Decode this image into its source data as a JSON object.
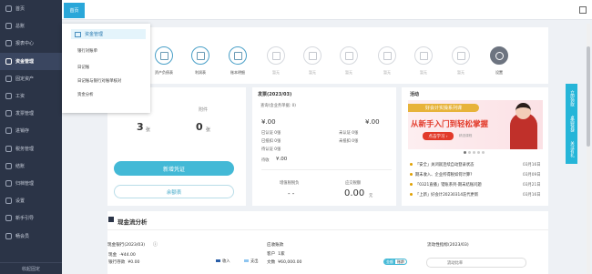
{
  "sidebar": {
    "items": [
      {
        "label": "首页",
        "icon": "home-icon"
      },
      {
        "label": "总账",
        "icon": "ledger-icon"
      },
      {
        "label": "报表中心",
        "icon": "report-icon"
      },
      {
        "label": "资金管理",
        "icon": "fund-icon"
      },
      {
        "label": "固定资产",
        "icon": "asset-icon"
      },
      {
        "label": "工资",
        "icon": "salary-icon"
      },
      {
        "label": "发票管理",
        "icon": "invoice-icon"
      },
      {
        "label": "进销存",
        "icon": "inventory-icon"
      },
      {
        "label": "税务管理",
        "icon": "tax-icon"
      },
      {
        "label": "结账",
        "icon": "closing-icon"
      },
      {
        "label": "归档管理",
        "icon": "archive-icon"
      },
      {
        "label": "设置",
        "icon": "settings-icon"
      },
      {
        "label": "新手引导",
        "icon": "guide-icon"
      },
      {
        "label": "畅会员",
        "icon": "vip-icon"
      }
    ],
    "active_index": 3,
    "bottom": "收起固定"
  },
  "tabs": {
    "home": "首页"
  },
  "menu": {
    "title": "资金管理",
    "items": [
      "银行对账单",
      "日记账",
      "日记账与银行对账单核对",
      "资金分析"
    ]
  },
  "shortcuts": [
    {
      "label": "资产负债表",
      "state": "active"
    },
    {
      "label": "利润表",
      "state": "active"
    },
    {
      "label": "账本明细",
      "state": "active"
    },
    {
      "label": "暂无",
      "state": "disabled"
    },
    {
      "label": "暂无",
      "state": "disabled"
    },
    {
      "label": "暂无",
      "state": "disabled"
    },
    {
      "label": "暂无",
      "state": "disabled"
    },
    {
      "label": "暂无",
      "state": "disabled"
    },
    {
      "label": "暂无",
      "state": "disabled"
    },
    {
      "label": "设置",
      "state": "dark"
    }
  ],
  "voucher": {
    "left_count": "3",
    "left_unit": "张",
    "right_label": "附件",
    "right_count": "0",
    "right_unit": "张",
    "primary_btn": "新增凭证",
    "secondary_btn": "余额表"
  },
  "bills": {
    "title": "发票(2023/03)",
    "query": "查询(含业务单据: 0)",
    "left_amount": "¥.00",
    "right_amount": "¥.00",
    "left_rows": [
      "已认证  0张",
      "已抵扣  0张",
      "待认证  0张"
    ],
    "right_rows": [
      "未认证  0张",
      "未抵扣  0张"
    ],
    "pending_label": "待收",
    "pending_value": "¥.00",
    "tax_label": "增值税税负",
    "tax_value": "- -",
    "due_label": "应交税额",
    "due_value": "0.00",
    "due_unit": "元"
  },
  "news": {
    "title": "活动",
    "banner_top": "好会计实操系列课",
    "banner_main": "从新手入门到轻松掌握",
    "banner_btn": "点击学习 ›",
    "banner_sub": "精选课程",
    "items": [
      {
        "text": "「安全」关闭就连续自动登录状态",
        "date": "03月16日"
      },
      {
        "text": "期末收入、企业所得税如何计算?",
        "date": "03月09日"
      },
      {
        "text": "「0321直播」错账系列-期末结账问题",
        "date": "03月21日"
      },
      {
        "text": "「上新」好会计20230314迭代更新",
        "date": "03月16日"
      }
    ]
  },
  "cashflow": {
    "title": "现金流分析",
    "bank_label": "现金银行(2023/03)",
    "cash_label": "现金",
    "cash_value": "-¥44.00",
    "bank_deposit_label": "银行存款",
    "bank_deposit_value": "¥0.00",
    "legend_in": "收入",
    "legend_out": "支出",
    "receivable_title": "应收账款",
    "customer_label": "客户",
    "customer_count": "1家",
    "doc_label": "文数",
    "doc_value": "¥60,000.00",
    "toggle_a": "金额",
    "toggle_b": "账龄",
    "ratio_title": "流动性指标(2023/03)",
    "ratio_label": "流动比率"
  },
  "float": [
    "立即领取",
    "桌面快捷",
    "关注有礼"
  ],
  "colors": {
    "sidebar_bg": "#2b3447",
    "accent": "#43b9d6",
    "banner_red": "#e23a2a"
  }
}
